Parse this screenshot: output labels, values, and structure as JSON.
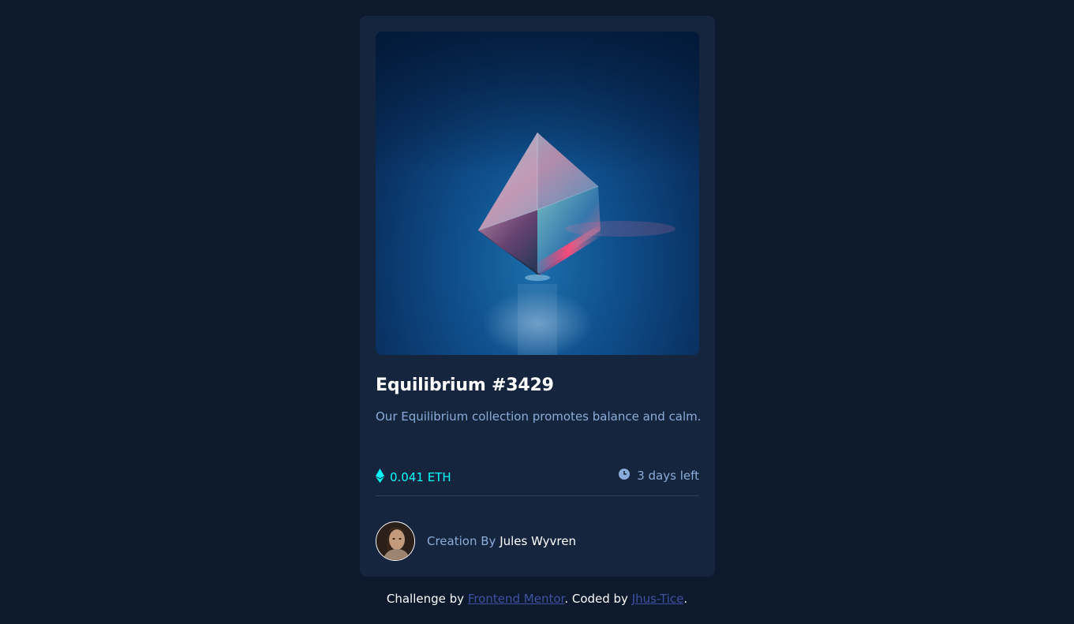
{
  "card": {
    "image_alt": "Equilibrium cube",
    "title": "Equilibrium #3429",
    "description": "Our Equilibrium collection promotes balance and calm.",
    "price": {
      "icon": "ethereum-icon",
      "value": "0.041 ETH"
    },
    "time": {
      "icon": "clock-icon",
      "value": "3 days left"
    },
    "creator": {
      "prefix": "Creation By",
      "name": "Jules Wyvren"
    }
  },
  "footer": {
    "challenge_prefix": "Challenge by",
    "challenge_link": "Frontend Mentor",
    "coded_prefix": ". Coded by",
    "coder_link": "Jhus-Tice",
    "suffix": "."
  },
  "colors": {
    "background": "#0d192c",
    "card": "#15253e",
    "cyan": "#00fff8",
    "soft_blue": "#8bacd9",
    "link": "#3e52a3",
    "white": "#ffffff"
  }
}
